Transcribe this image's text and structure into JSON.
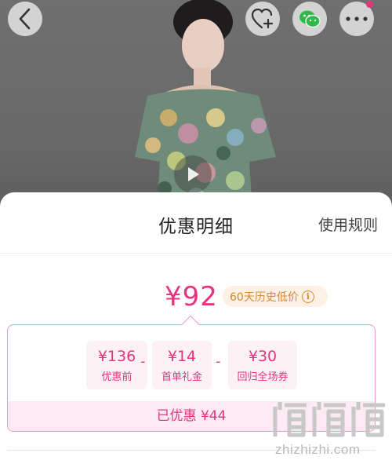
{
  "top_bar": {
    "back": "chevron-left-icon",
    "favorite": "heart-plus-icon",
    "share": "wechat-icon",
    "more": "more-dots-icon"
  },
  "sheet": {
    "title": "优惠明细",
    "rules_link": "使用规则"
  },
  "price": {
    "final": "¥92",
    "history_tag": "60天历史低价"
  },
  "breakdown": {
    "items": [
      {
        "value": "¥136",
        "label": "优惠前"
      },
      {
        "value": "¥14",
        "label": "首单礼金"
      },
      {
        "value": "¥30",
        "label": "回归全场券"
      }
    ],
    "operators": [
      "-",
      "-"
    ],
    "saved": "已优惠 ¥44"
  },
  "watermark": {
    "logo": "值值值",
    "text": "zhizhizhi.com"
  },
  "colors": {
    "accent": "#e8337f",
    "tag_text": "#d58a32",
    "tag_bg": "#fdf0e4"
  }
}
